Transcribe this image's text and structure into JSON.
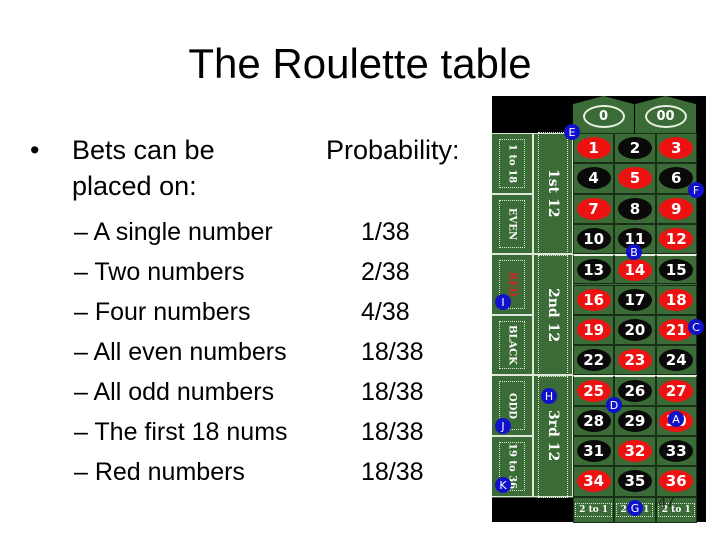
{
  "slide": {
    "title": "The Roulette table",
    "bullet": {
      "marker": "•",
      "text_line1": "Bets can be",
      "text_line2": "placed on:"
    },
    "probability_header": "Probability:",
    "bets": [
      {
        "label": "– A single number",
        "probability": "1/38"
      },
      {
        "label": "– Two numbers",
        "probability": "2/38"
      },
      {
        "label": "– Four numbers",
        "probability": "4/38"
      },
      {
        "label": "– All even numbers",
        "probability": "18/38"
      },
      {
        "label": "– All odd numbers",
        "probability": "18/38"
      },
      {
        "label": "– The first 18 nums",
        "probability": "18/38"
      },
      {
        "label": "– Red numbers",
        "probability": "18/38"
      }
    ],
    "page_number": "47"
  },
  "roulette": {
    "zeros": [
      "0",
      "00"
    ],
    "red_color": "#ee1111",
    "black_color": "#0a0a0a",
    "felt_color": "#3b6b36",
    "marker_color": "#1111cc",
    "numbers": [
      {
        "n": "1",
        "c": "red"
      },
      {
        "n": "2",
        "c": "black"
      },
      {
        "n": "3",
        "c": "red"
      },
      {
        "n": "4",
        "c": "black"
      },
      {
        "n": "5",
        "c": "red"
      },
      {
        "n": "6",
        "c": "black"
      },
      {
        "n": "7",
        "c": "red"
      },
      {
        "n": "8",
        "c": "black"
      },
      {
        "n": "9",
        "c": "red"
      },
      {
        "n": "10",
        "c": "black"
      },
      {
        "n": "11",
        "c": "black"
      },
      {
        "n": "12",
        "c": "red"
      },
      {
        "n": "13",
        "c": "black"
      },
      {
        "n": "14",
        "c": "red"
      },
      {
        "n": "15",
        "c": "black"
      },
      {
        "n": "16",
        "c": "red"
      },
      {
        "n": "17",
        "c": "black"
      },
      {
        "n": "18",
        "c": "red"
      },
      {
        "n": "19",
        "c": "red"
      },
      {
        "n": "20",
        "c": "black"
      },
      {
        "n": "21",
        "c": "red"
      },
      {
        "n": "22",
        "c": "black"
      },
      {
        "n": "23",
        "c": "red"
      },
      {
        "n": "24",
        "c": "black"
      },
      {
        "n": "25",
        "c": "red"
      },
      {
        "n": "26",
        "c": "black"
      },
      {
        "n": "27",
        "c": "red"
      },
      {
        "n": "28",
        "c": "black"
      },
      {
        "n": "29",
        "c": "black"
      },
      {
        "n": "30",
        "c": "red"
      },
      {
        "n": "31",
        "c": "black"
      },
      {
        "n": "32",
        "c": "red"
      },
      {
        "n": "33",
        "c": "black"
      },
      {
        "n": "34",
        "c": "red"
      },
      {
        "n": "35",
        "c": "black"
      },
      {
        "n": "36",
        "c": "red"
      }
    ],
    "outside_bets": [
      {
        "label": "1 to 18",
        "style": "normal"
      },
      {
        "label": "EVEN",
        "style": "normal"
      },
      {
        "label": "RED",
        "style": "red"
      },
      {
        "label": "BLACK",
        "style": "normal"
      },
      {
        "label": "ODD",
        "style": "normal"
      },
      {
        "label": "19 to 36",
        "style": "normal"
      }
    ],
    "dozens": [
      "1st 12",
      "2nd 12",
      "3rd 12"
    ],
    "columns": [
      "2 to 1",
      "2 to 1",
      "2 to 1"
    ],
    "markers": [
      {
        "id": "A",
        "at": "30"
      },
      {
        "id": "B",
        "at": "11/14 split"
      },
      {
        "id": "C",
        "at": "21 right edge"
      },
      {
        "id": "D",
        "at": "25/26/28/29 corner"
      },
      {
        "id": "E",
        "at": "top-left of 1"
      },
      {
        "id": "F",
        "at": "6/9 right edge"
      },
      {
        "id": "G",
        "at": "middle 2 to 1"
      },
      {
        "id": "H",
        "at": "3rd 12"
      },
      {
        "id": "I",
        "at": "RED"
      },
      {
        "id": "J",
        "at": "ODD"
      },
      {
        "id": "K",
        "at": "19 to 36"
      }
    ]
  }
}
